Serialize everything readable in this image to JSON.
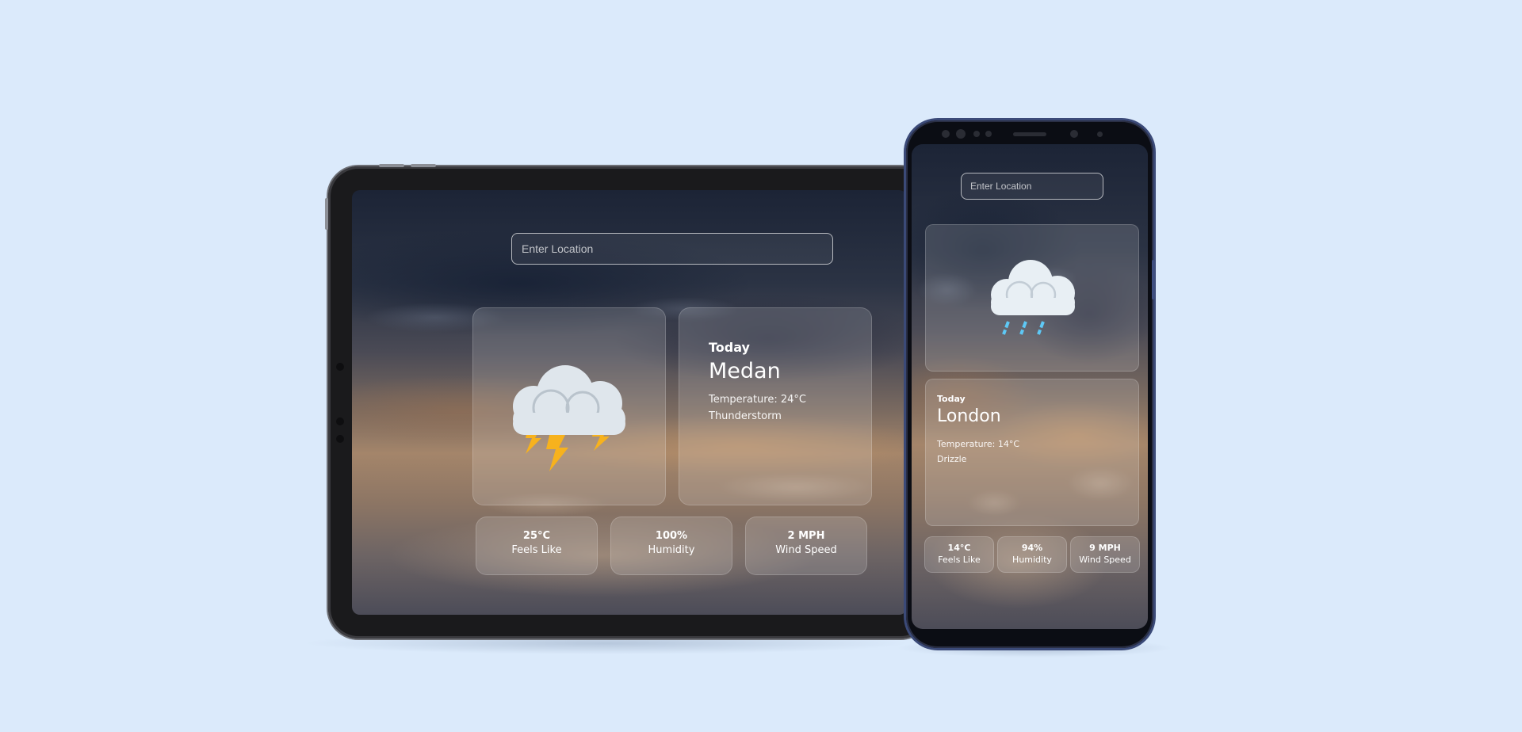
{
  "tablet": {
    "search": {
      "placeholder": "Enter Location"
    },
    "weather_icon": "thunderstorm-cloud-icon",
    "day_label": "Today",
    "city": "Medan",
    "temperature": "Temperature: 24°C",
    "condition": "Thunderstorm",
    "stats": [
      {
        "value": "25°C",
        "label": "Feels Like"
      },
      {
        "value": "100%",
        "label": "Humidity"
      },
      {
        "value": "2 MPH",
        "label": "Wind Speed"
      }
    ]
  },
  "phone": {
    "search": {
      "placeholder": "Enter Location"
    },
    "weather_icon": "rain-cloud-icon",
    "day_label": "Today",
    "city": "London",
    "temperature": "Temperature: 14°C",
    "condition": "Drizzle",
    "stats": [
      {
        "value": "14°C",
        "label": "Feels Like"
      },
      {
        "value": "94%",
        "label": "Humidity"
      },
      {
        "value": "9 MPH",
        "label": "Wind Speed"
      }
    ]
  },
  "colors": {
    "page_background": "#dbeafb",
    "lightning": "#f7b21d",
    "rain": "#5ec8f5",
    "cloud": "#dfe6ec"
  }
}
